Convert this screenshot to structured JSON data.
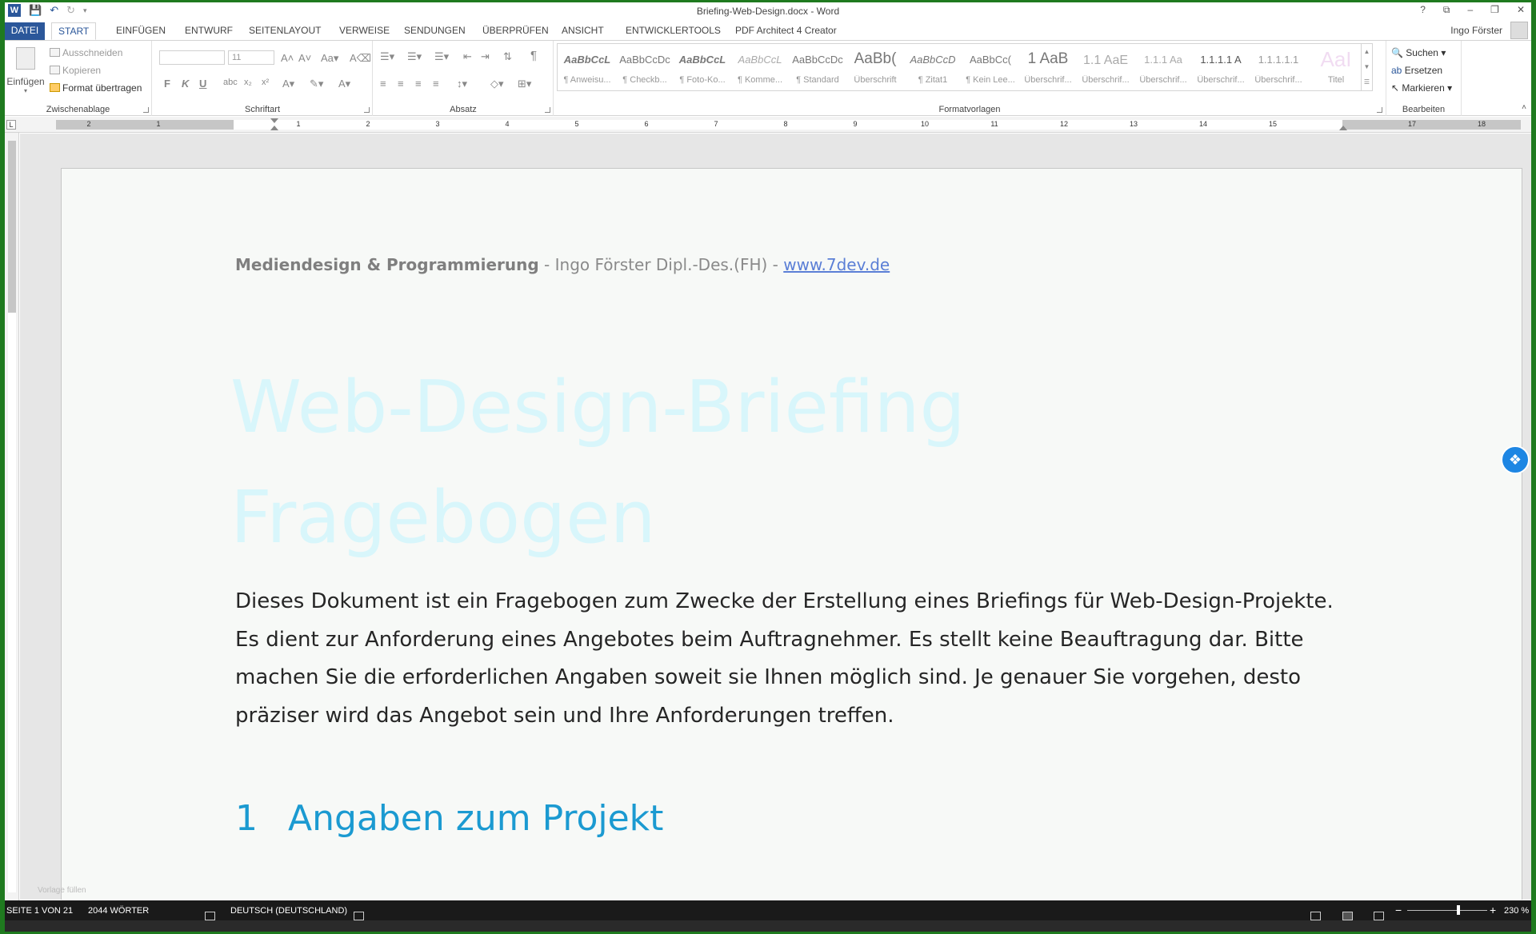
{
  "titlebar": {
    "document_title": "Briefing-Web-Design.docx - Word",
    "app_icon": "W",
    "quick_access": [
      "save-icon",
      "undo-icon",
      "redo-icon",
      "customize-icon"
    ],
    "window_controls": [
      "?",
      "⧉",
      "–",
      "❐",
      "✕"
    ]
  },
  "tabs": {
    "file": "DATEI",
    "items": [
      "START",
      "EINFÜGEN",
      "ENTWURF",
      "SEITENLAYOUT",
      "VERWEISE",
      "SENDUNGEN",
      "ÜBERPRÜFEN",
      "ANSICHT",
      "ENTWICKLERTOOLS",
      "PDF Architect 4 Creator"
    ],
    "active": "START",
    "user": "Ingo Förster"
  },
  "ribbon": {
    "clipboard": {
      "label": "Zwischenablage",
      "paste": "Einfügen",
      "cut": "Ausschneiden",
      "copy": "Kopieren",
      "format_painter": "Format übertragen"
    },
    "font": {
      "label": "Schriftart",
      "font_name": "",
      "font_size": "11",
      "bold": "F",
      "italic": "K",
      "underline": "U"
    },
    "paragraph": {
      "label": "Absatz"
    },
    "styles": {
      "label": "Formatvorlagen",
      "items": [
        {
          "preview": "AaBbCcL",
          "name": "¶ Anweisu..."
        },
        {
          "preview": "AaBbCcDc",
          "name": "¶ Checkb..."
        },
        {
          "preview": "AaBbCcL",
          "name": "¶ Foto-Ko..."
        },
        {
          "preview": "AaBbCcL",
          "name": "¶ Komme..."
        },
        {
          "preview": "AaBbCcDc",
          "name": "¶ Standard"
        },
        {
          "preview": "AaBb(",
          "name": "Überschrift"
        },
        {
          "preview": "AaBbCcD",
          "name": "¶ Zitat1"
        },
        {
          "preview": "AaBbCc(",
          "name": "¶ Kein Lee..."
        },
        {
          "preview": "1 AaB",
          "name": "Überschrif..."
        },
        {
          "preview": "1.1 AaE",
          "name": "Überschrif..."
        },
        {
          "preview": "1.1.1 Aa",
          "name": "Überschrif..."
        },
        {
          "preview": "1.1.1.1 A",
          "name": "Überschrif..."
        },
        {
          "preview": "1.1.1.1.1",
          "name": "Überschrif..."
        },
        {
          "preview": "AaI",
          "name": "Titel"
        }
      ]
    },
    "editing": {
      "label": "Bearbeiten",
      "find": "Suchen",
      "replace": "Ersetzen",
      "select": "Markieren"
    }
  },
  "ruler": {
    "corner": "L",
    "numbers": [
      "2",
      "1",
      "1",
      "2",
      "3",
      "4",
      "5",
      "6",
      "7",
      "8",
      "9",
      "10",
      "11",
      "12",
      "13",
      "14",
      "15",
      "17",
      "18"
    ]
  },
  "document": {
    "header_strong": "Mediendesign & Programmierung",
    "header_rest": " - Ingo Förster  Dipl.-Des.(FH)  -  ",
    "header_link": "www.7dev.de",
    "title_line1": "Web-Design-Briefing",
    "title_line2": "Fragebogen",
    "intro": "Dieses Dokument ist ein Fragebogen zum Zwecke der Erstellung eines Briefings für Web-Design-Projekte. Es dient zur Anforderung eines Angebotes beim Auftragnehmer. Es stellt keine Beauftragung dar. Bitte machen Sie die erforderlichen Angaben soweit sie Ihnen möglich sind. Je genauer Sie vorgehen, desto präziser wird das Angebot sein und Ihre Anforderungen treffen.",
    "heading_number": "1",
    "heading_text": "Angaben zum Projekt",
    "template_note": "Vorlage füllen"
  },
  "statusbar": {
    "page": "SEITE 1 VON 21",
    "words": "2044 WÖRTER",
    "language": "DEUTSCH (DEUTSCHLAND)",
    "zoom": "230 %",
    "zoom_minus": "−",
    "zoom_plus": "+"
  },
  "colors": {
    "accent": "#2b579a",
    "heading": "#1b9ad1",
    "title": "#d8f6fb",
    "link": "#5b7fd6",
    "frame": "#1f7a1f"
  }
}
